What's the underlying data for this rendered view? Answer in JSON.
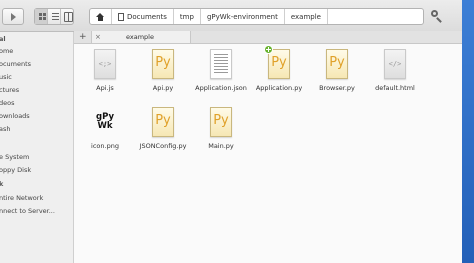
{
  "header": {
    "breadcrumb": [
      "Documents",
      "tmp",
      "gPyWk-environment",
      "example"
    ],
    "home_icon": "home-icon",
    "search_icon": "search-icon"
  },
  "sidebar": {
    "items": [
      "al",
      "ome",
      "ocuments",
      "usic",
      "ctures",
      "deos",
      "ownloads",
      "ash",
      "e System",
      "oppy Disk",
      "k",
      "ntire Network",
      "nnect to Server..."
    ]
  },
  "tabs": {
    "add": "+",
    "items": [
      {
        "label": "example",
        "close": "×"
      }
    ]
  },
  "files": [
    {
      "name": "Api.js",
      "icon": "js-file-icon"
    },
    {
      "name": "Api.py",
      "icon": "python-file-icon"
    },
    {
      "name": "Application.json",
      "icon": "json-file-icon"
    },
    {
      "name": "Application.py",
      "icon": "python-file-icon",
      "badge": "new-badge-icon"
    },
    {
      "name": "Browser.py",
      "icon": "python-file-icon"
    },
    {
      "name": "default.html",
      "icon": "html-file-icon"
    },
    {
      "name": "icon.png",
      "icon": "image-file-icon",
      "thumbnail_text": [
        "gPy",
        "Wk"
      ]
    },
    {
      "name": "JSONConfig.py",
      "icon": "python-file-icon"
    },
    {
      "name": "Main.py",
      "icon": "python-file-icon"
    }
  ],
  "icon_glyphs": {
    "js": "<;>",
    "html": "</>",
    "py": "Py"
  },
  "colors": {
    "accent": "#2a6cc7",
    "python": "#e0a12a",
    "badge": "#67b22d"
  }
}
